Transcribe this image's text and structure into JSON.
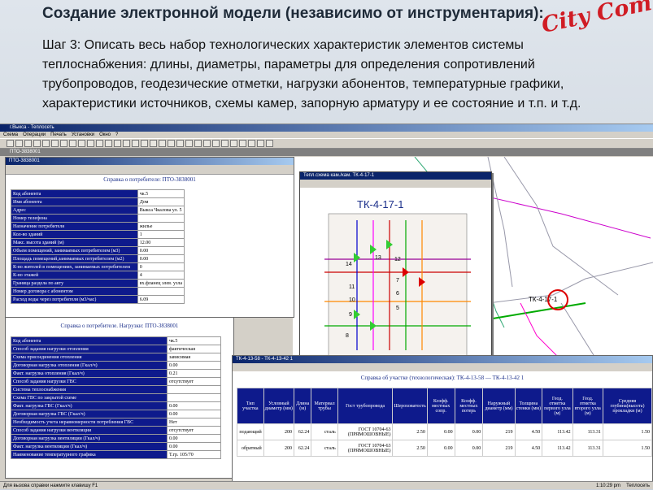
{
  "slide": {
    "title": "Создание электронной модели (независимо от инструментария):",
    "logo": "City Com",
    "step_label": "Шаг 3:",
    "step_text": "Описать весь набор технологических характеристик элементов системы теплоснабжения: длины, диаметры, параметры для определения сопротивлений трубопроводов, геодезические отметки, нагрузки абонентов, температурные графики, характеристики источников, схемы камер, запорную арматуру и ее состояние и т.п. и т.д."
  },
  "app": {
    "window_title": "г.Выкса - Теплосеть",
    "menu": [
      "Схема",
      "Операции",
      "Печать",
      "Установки",
      "Окно",
      "?"
    ],
    "subbar": "ПТО-3838001"
  },
  "consumer": {
    "window_title": "ПТО-3838001",
    "title": "Справка о потребителе: ПТО-3838001",
    "rows": [
      {
        "k": "Код абонента",
        "v": "чк.5"
      },
      {
        "k": "Имя абонента",
        "v": "Дом"
      },
      {
        "k": "Адрес",
        "v": "Выкса Чкалова ул. 5"
      },
      {
        "k": "Номер телефона",
        "v": ""
      },
      {
        "k": "Назначение потребителя",
        "v": "жилье"
      },
      {
        "k": "Кол-во зданий",
        "v": "1"
      },
      {
        "k": "Макс. высота зданий (м)",
        "v": "12.00"
      },
      {
        "k": "Объем помещений, занимаемых потребителем (м3)",
        "v": "0.00"
      },
      {
        "k": "Площадь помещений,занимаемых потребителем (м2)",
        "v": "0.00"
      },
      {
        "k": "К-во жителей в помещениях, занимаемых потребителем",
        "v": "0"
      },
      {
        "k": "К-во этажей",
        "v": "4"
      },
      {
        "k": "Граница раздела по акту",
        "v": "вх.фланец элев. узла"
      },
      {
        "k": "Номер договора с абонентом",
        "v": ""
      },
      {
        "k": "Расход воды через потребителя (м3/час)",
        "v": "6.09"
      }
    ]
  },
  "loads": {
    "title": "Справка о потребителе. Нагрузки: ПТО-3838001",
    "rows": [
      {
        "k": "Код абонента",
        "v": "чк.5"
      },
      {
        "k": "Способ задания нагрузки отопления",
        "v": "фактическая"
      },
      {
        "k": "Схема присоединения отопления",
        "v": "зависимая"
      },
      {
        "k": "Договорная нагрузка отопления (Гкал/ч)",
        "v": "0.00"
      },
      {
        "k": "Факт. нагрузка отопления (Гкал/ч)",
        "v": "0.21"
      },
      {
        "k": "Способ задания нагрузки ГВС",
        "v": "отсутствует"
      },
      {
        "k": "Система теплоснабжения",
        "v": ""
      },
      {
        "k": "Схема ГВС по закрытой схеме",
        "v": ""
      },
      {
        "k": "Факт. нагрузка ГВС (Гкал/ч)",
        "v": "0.00"
      },
      {
        "k": "Договорная нагрузка ГВС (Гкал/ч)",
        "v": "0.00"
      },
      {
        "k": "Необходимость учета неравномерности потребления ГВС",
        "v": "Нет"
      },
      {
        "k": "Способ задания нагрузки вентиляции",
        "v": "отсутствует"
      },
      {
        "k": "Договорная нагрузка вентиляции (Гкал/ч)",
        "v": "0.00"
      },
      {
        "k": "Факт. нагрузка вентиляции (Гкал/ч)",
        "v": "0.00"
      },
      {
        "k": "Наименование температурного графика",
        "v": "Т.гр. 105/70"
      }
    ]
  },
  "scheme": {
    "window_title": "Тепл.схема кам./кам. ТК-4-17-1",
    "title": "ТК-4-17-1",
    "labels": [
      "14",
      "13",
      "12",
      "11",
      "10",
      "9",
      "8",
      "7",
      "6",
      "5"
    ]
  },
  "map": {
    "label": "ТК-4-17-1"
  },
  "section": {
    "window_title": "ТК-4-13-58 - ТК-4-13-42 1",
    "title": "Справка об участке (технологическая): ТК-4-13-58 — ТК-4-13-42 1",
    "headers": [
      "Тип участка",
      "Условный диаметр (мм)",
      "Длина (м)",
      "Материал трубы",
      "Гост трубопровода",
      "Шероховатость",
      "Коэфф. местных сопр.",
      "Коэфф. местных потерь",
      "Наружный диаметр (мм)",
      "Толщина стенки (мм)",
      "Геод. отметка первого узла (м)",
      "Геод. отметка второго узла (м)",
      "Средняя глубина(высота) прокладки (м)"
    ],
    "rows": [
      [
        "подающий",
        "200",
        "62.24",
        "сталь",
        "ГОСТ 10704-63 (ПРЯМОШОВНЫЕ)",
        "2.50",
        "0.00",
        "0.00",
        "219",
        "4.50",
        "113.42",
        "113.31",
        "1.50"
      ],
      [
        "обратный",
        "200",
        "62.24",
        "сталь",
        "ГОСТ 10704-63 (ПРЯМОШОВНЫЕ)",
        "2.50",
        "0.00",
        "0.00",
        "219",
        "4.50",
        "113.42",
        "113.31",
        "1.50"
      ]
    ]
  },
  "status": {
    "left": "Для вызова справки нажмите клавишу F1",
    "time": "1:10:29 pm",
    "app": "Теплосеть"
  }
}
